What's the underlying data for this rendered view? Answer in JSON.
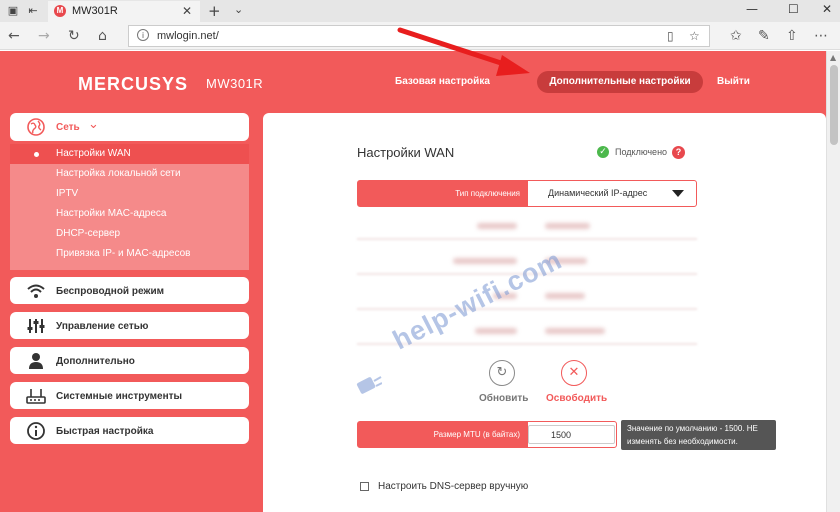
{
  "browser": {
    "tab_title": "MW301R",
    "tab_favicon": "M",
    "url": "mwlogin.net/",
    "colors": {
      "chrome": "#e6e6e6",
      "tab": "#f3f3f3"
    }
  },
  "router": {
    "logo": "MERCUSYS",
    "model": "MW301R",
    "top_nav": {
      "basic": "Базовая настройка",
      "advanced": "Дополнительные настройки",
      "logout": "Выйти"
    },
    "sidebar": {
      "network": {
        "label": "Сеть",
        "items": [
          "Настройки WAN",
          "Настройка локальной сети",
          "IPTV",
          "Настройки MAC-адреса",
          "DHCP-сервер",
          "Привязка IP- и MAC-адресов"
        ],
        "selected_index": 0
      },
      "sections": [
        {
          "label": "Беспроводной режим",
          "icon": "wifi-icon"
        },
        {
          "label": "Управление сетью",
          "icon": "sliders-icon"
        },
        {
          "label": "Дополнительно",
          "icon": "user-icon"
        },
        {
          "label": "Системные инструменты",
          "icon": "router-icon"
        },
        {
          "label": "Быстрая настройка",
          "icon": "info-icon"
        }
      ]
    },
    "main": {
      "title": "Настройки WAN",
      "status": "Подключено",
      "connection_type": {
        "label": "Тип подключения",
        "value": "Динамический IP-адрес"
      },
      "buttons": {
        "renew": "Обновить",
        "release": "Освободить"
      },
      "mtu": {
        "label": "Размер MTU (в байтах)",
        "value": "1500",
        "hint": "Значение по умолчанию - 1500. НЕ изменять без необходимости."
      },
      "dns_checkbox": "Настроить DNS-сервер вручную"
    },
    "watermark": "help-wifi.com",
    "colors": {
      "accent": "#f25a5a",
      "dark_accent": "#c83c3c",
      "ok": "#4cb84c"
    }
  }
}
